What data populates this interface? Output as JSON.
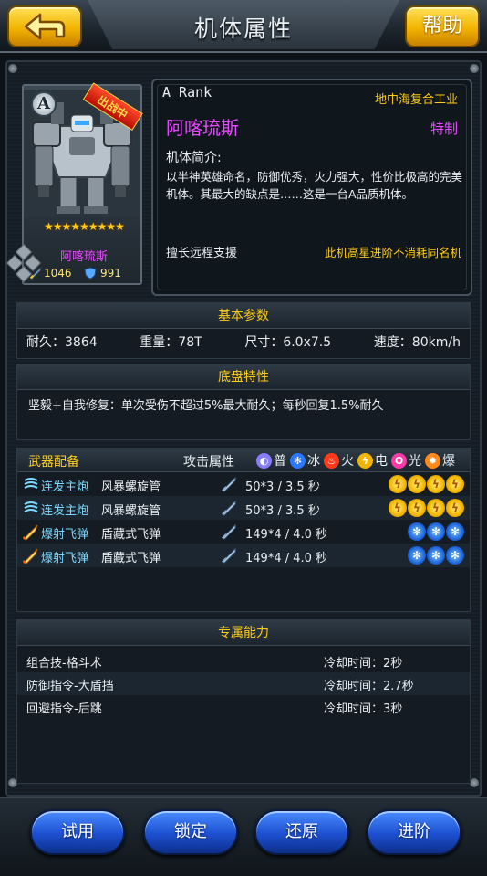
{
  "header": {
    "title": "机体属性",
    "help_label": "帮助"
  },
  "mech_card": {
    "rank_letter": "A",
    "status_badge": "出战中",
    "stars": "★★★★★★★★★",
    "star_count": 9,
    "name": "阿喀琉斯",
    "attack": "1046",
    "defense": "991"
  },
  "info": {
    "rank_text": "A Rank",
    "manufacturer": "地中海复合工业",
    "name": "阿喀琉斯",
    "special": "特制",
    "intro_heading": "机体简介:",
    "intro": "以半神英雄命名，防御优秀，火力强大，性价比极高的完美机体。其最大的缺点是……这是一台A品质机体。",
    "specialty": "擅长远程支援",
    "note": "此机高星进阶不消耗同名机"
  },
  "basic_params": {
    "heading": "基本参数",
    "items": [
      "耐久：3864",
      "重量：78T",
      "尺寸：6.0x7.5",
      "速度：80km/h"
    ]
  },
  "chassis": {
    "heading": "底盘特性",
    "text": "坚毅+自我修复：单次受伤不超过5%最大耐久；每秒回复1.5%耐久"
  },
  "weapons": {
    "heading": "武器配备",
    "attr_label": "攻击属性",
    "legend": [
      {
        "symbol": "◐",
        "label": "普",
        "color": "#8a7cff"
      },
      {
        "symbol": "✻",
        "label": "冰",
        "color": "#2a78ff"
      },
      {
        "symbol": "♨",
        "label": "火",
        "color": "#ff3a1a"
      },
      {
        "symbol": "ϟ",
        "label": "电",
        "color": "#f2b400"
      },
      {
        "symbol": "O",
        "label": "光",
        "color": "#ff3aa8"
      },
      {
        "symbol": "✹",
        "label": "爆",
        "color": "#ff8a1a"
      }
    ],
    "rows": [
      {
        "type": "连发主炮",
        "name": "风暴螺旋管",
        "damage": "50*3 / 3.5 秒",
        "element": "bolt",
        "element_glyph": "ϟ",
        "element_count": 4
      },
      {
        "type": "连发主炮",
        "name": "风暴螺旋管",
        "damage": "50*3 / 3.5 秒",
        "element": "bolt",
        "element_glyph": "ϟ",
        "element_count": 4
      },
      {
        "type": "爆射飞弹",
        "name": "盾藏式飞弹",
        "damage": "149*4 / 4.0 秒",
        "element": "snow",
        "element_glyph": "✻",
        "element_count": 3
      },
      {
        "type": "爆射飞弹",
        "name": "盾藏式飞弹",
        "damage": "149*4 / 4.0 秒",
        "element": "snow",
        "element_glyph": "✻",
        "element_count": 3
      }
    ]
  },
  "abilities": {
    "heading": "专属能力",
    "rows": [
      {
        "name": "组合技-格斗术",
        "cooldown": "冷却时间：2秒"
      },
      {
        "name": "防御指令-大盾挡",
        "cooldown": "冷却时间：2.7秒"
      },
      {
        "name": "回避指令-后跳",
        "cooldown": "冷却时间：3秒"
      }
    ]
  },
  "buttons": {
    "trial": "试用",
    "lock": "锁定",
    "restore": "还原",
    "upgrade": "进阶"
  }
}
